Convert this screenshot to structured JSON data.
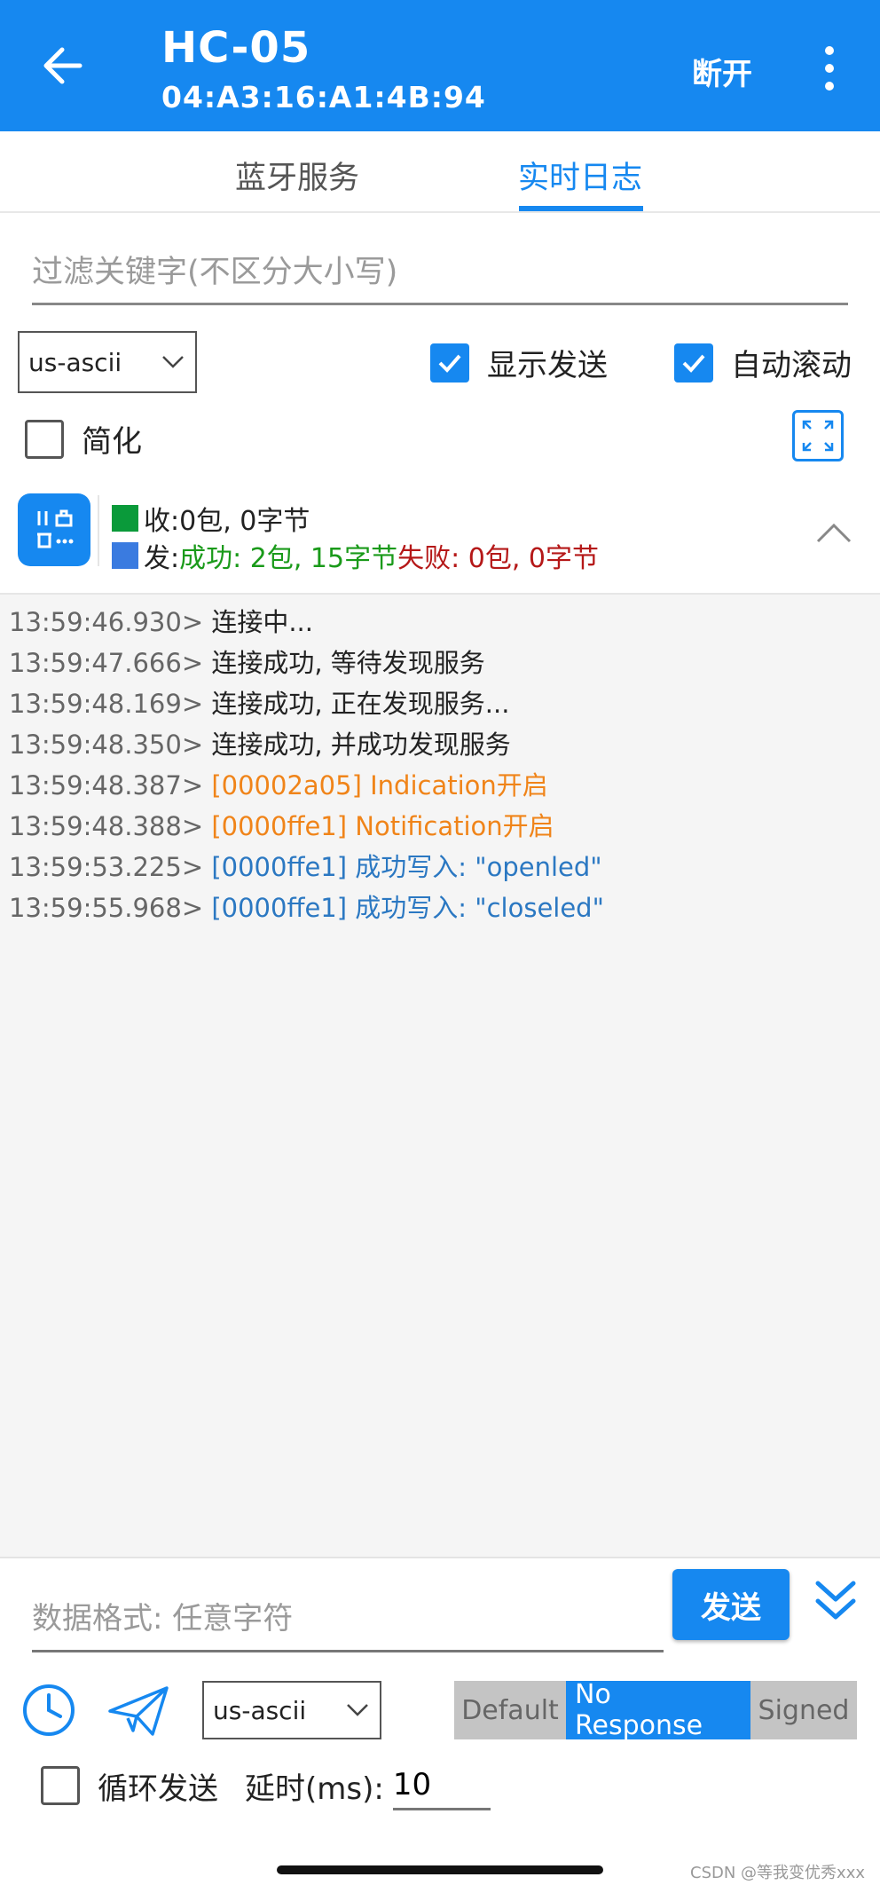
{
  "appbar": {
    "title": "HC-05",
    "address": "04:A3:16:A1:4B:94",
    "disconnect_label": "断开"
  },
  "tabs": [
    {
      "label": "蓝牙服务"
    },
    {
      "label": "实时日志"
    }
  ],
  "filter": {
    "placeholder": "过滤关键字(不区分大小写)"
  },
  "options": {
    "encoding": "us-ascii",
    "show_send_label": "显示发送",
    "auto_scroll_label": "自动滚动",
    "simplify_label": "简化"
  },
  "stats": {
    "rx_prefix": "收:",
    "rx_value": " 0包, 0字节",
    "tx_prefix": "发:",
    "tx_success": " 成功: 2包, 15字节",
    "tx_fail": " 失败: 0包, 0字节",
    "rx_color": "#0a9a3a",
    "tx_color": "#3a7be0"
  },
  "logs": [
    {
      "time": "13:59:46.930>",
      "msg": " 连接中..."
    },
    {
      "time": "13:59:47.666>",
      "msg": " 连接成功, 等待发现服务"
    },
    {
      "time": "13:59:48.169>",
      "msg": " 连接成功, 正在发现服务..."
    },
    {
      "time": "13:59:48.350>",
      "msg": " 连接成功, 并成功发现服务"
    },
    {
      "time": "13:59:48.387>",
      "msg": " [00002a05] Indication开启"
    },
    {
      "time": "13:59:48.388>",
      "msg": " [0000ffe1] Notification开启"
    },
    {
      "time": "13:59:53.225>",
      "msg": " [0000ffe1] 成功写入: \"openled\""
    },
    {
      "time": "13:59:55.968>",
      "msg": " [0000ffe1] 成功写入: \"closeled\""
    }
  ],
  "send": {
    "placeholder": "数据格式: 任意字符",
    "send_label": "发送",
    "encoding": "us-ascii",
    "write_types": [
      "Default",
      "No Response",
      "Signed"
    ],
    "loop_label": "循环发送",
    "delay_label": "延时(ms):",
    "delay_value": "10"
  },
  "watermark": "CSDN @等我变优秀xxx",
  "colors": {
    "accent": "#1688f0",
    "orange": "#f08419",
    "blue_log": "#2b78c2",
    "success": "#1a9a1a",
    "fail": "#b51818"
  }
}
